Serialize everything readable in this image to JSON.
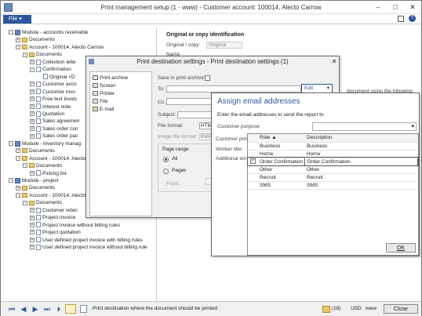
{
  "window": {
    "title": "Print management setup (1 - www) - Customer account: 100014, Alecto Carrow",
    "controls": [
      "–",
      "□",
      "✕"
    ]
  },
  "ribbon": {
    "file_label": "File ▾"
  },
  "tree": [
    {
      "label": "Module - accounts receivable",
      "level": 0,
      "pm": "−",
      "icon": "module"
    },
    {
      "label": "Documents",
      "level": 1,
      "pm": "+",
      "icon": "folder"
    },
    {
      "label": "Account - 100014, Alecto Carrow",
      "level": 1,
      "pm": "−",
      "icon": "folder"
    },
    {
      "label": "Documents",
      "level": 2,
      "pm": "−",
      "icon": "folder"
    },
    {
      "label": "Collection lette",
      "level": 3,
      "pm": "+",
      "icon": "doc"
    },
    {
      "label": "Confirmation",
      "level": 3,
      "pm": "−",
      "icon": "doc"
    },
    {
      "label": "Original <D",
      "level": 4,
      "pm": "",
      "icon": "doc"
    },
    {
      "label": "Customer acco",
      "level": 3,
      "pm": "+",
      "icon": "doc"
    },
    {
      "label": "Customer invo",
      "level": 3,
      "pm": "+",
      "icon": "doc"
    },
    {
      "label": "Free text invoic",
      "level": 3,
      "pm": "+",
      "icon": "doc"
    },
    {
      "label": "Interest note",
      "level": 3,
      "pm": "+",
      "icon": "doc"
    },
    {
      "label": "Quotation",
      "level": 3,
      "pm": "+",
      "icon": "doc"
    },
    {
      "label": "Sales agreemen",
      "level": 3,
      "pm": "+",
      "icon": "doc"
    },
    {
      "label": "Sales order con",
      "level": 3,
      "pm": "+",
      "icon": "doc"
    },
    {
      "label": "Sales order pac",
      "level": 3,
      "pm": "+",
      "icon": "doc"
    },
    {
      "label": "Module - inventory manag",
      "level": 0,
      "pm": "−",
      "icon": "module"
    },
    {
      "label": "Documents",
      "level": 1,
      "pm": "+",
      "icon": "folder"
    },
    {
      "label": "Account - 100014, Alecto",
      "level": 1,
      "pm": "−",
      "icon": "folder"
    },
    {
      "label": "Documents",
      "level": 2,
      "pm": "−",
      "icon": "folder"
    },
    {
      "label": "Picking list",
      "level": 3,
      "pm": "+",
      "icon": "doc"
    },
    {
      "label": "Module - project",
      "level": 0,
      "pm": "−",
      "icon": "module"
    },
    {
      "label": "Documents",
      "level": 1,
      "pm": "+",
      "icon": "folder"
    },
    {
      "label": "Account - 100014, Alecto Carrow",
      "level": 1,
      "pm": "−",
      "icon": "folder"
    },
    {
      "label": "Documents",
      "level": 2,
      "pm": "−",
      "icon": "folder"
    },
    {
      "label": "Customer reten",
      "level": 3,
      "pm": "+",
      "icon": "doc"
    },
    {
      "label": "Project invoice",
      "level": 3,
      "pm": "+",
      "icon": "doc"
    },
    {
      "label": "Project invoice without billing rules",
      "level": 3,
      "pm": "+",
      "icon": "doc"
    },
    {
      "label": "Project quotation",
      "level": 3,
      "pm": "+",
      "icon": "doc"
    },
    {
      "label": "User defined project invoice with billing rules",
      "level": 3,
      "pm": "+",
      "icon": "doc"
    },
    {
      "label": "User defined project invoice without billing rule",
      "level": 3,
      "pm": "+",
      "icon": "doc"
    }
  ],
  "right_panel": {
    "heading": "Original or copy identification",
    "orig_label": "Original / copy:",
    "orig_value": "Original",
    "name_label": "Name",
    "hint": "document using the following"
  },
  "print_dest": {
    "title": "Print destination settings - Print destination settings (1)",
    "destinations": [
      "Print archive",
      "Screen",
      "Printer",
      "File",
      "E-mail"
    ],
    "save_archive_label": "Save in print archive?",
    "to_label": "To:",
    "edit_label": "Edit",
    "cc_label": "Cc:",
    "subject_label": "Subject:",
    "file_format_label": "File format:",
    "file_format_value": "HTM",
    "image_format_label": "Image file format:",
    "image_format_value": "BMP",
    "page_range_label": "Page range",
    "all_label": "All",
    "pages_label": "Pages",
    "from_label": "From:"
  },
  "email_dialog": {
    "title": "Assign email addresses",
    "instruction": "Enter the email addresses to send the report to",
    "purpose_label": "Customer purpose:",
    "side_labels": [
      "Customer prim",
      "Worker title:",
      "Additional em"
    ],
    "col_role": "Role",
    "col_desc": "Description",
    "rows": [
      {
        "role": "Business",
        "desc": "Business",
        "checked": false
      },
      {
        "role": "Home",
        "desc": "Home",
        "checked": false
      },
      {
        "role": "Order Confirmation",
        "desc": "Order Confirmation",
        "checked": true
      },
      {
        "role": "Other",
        "desc": "Other",
        "checked": false
      },
      {
        "role": "Recruit",
        "desc": "Recruit",
        "checked": false
      },
      {
        "role": "SMS",
        "desc": "SMS",
        "checked": false
      }
    ],
    "ok_label": "OK"
  },
  "status": {
    "text": "Print destination where the document should be printed",
    "count": "(18)",
    "currency": "USD",
    "company": "www",
    "close_label": "Close"
  }
}
